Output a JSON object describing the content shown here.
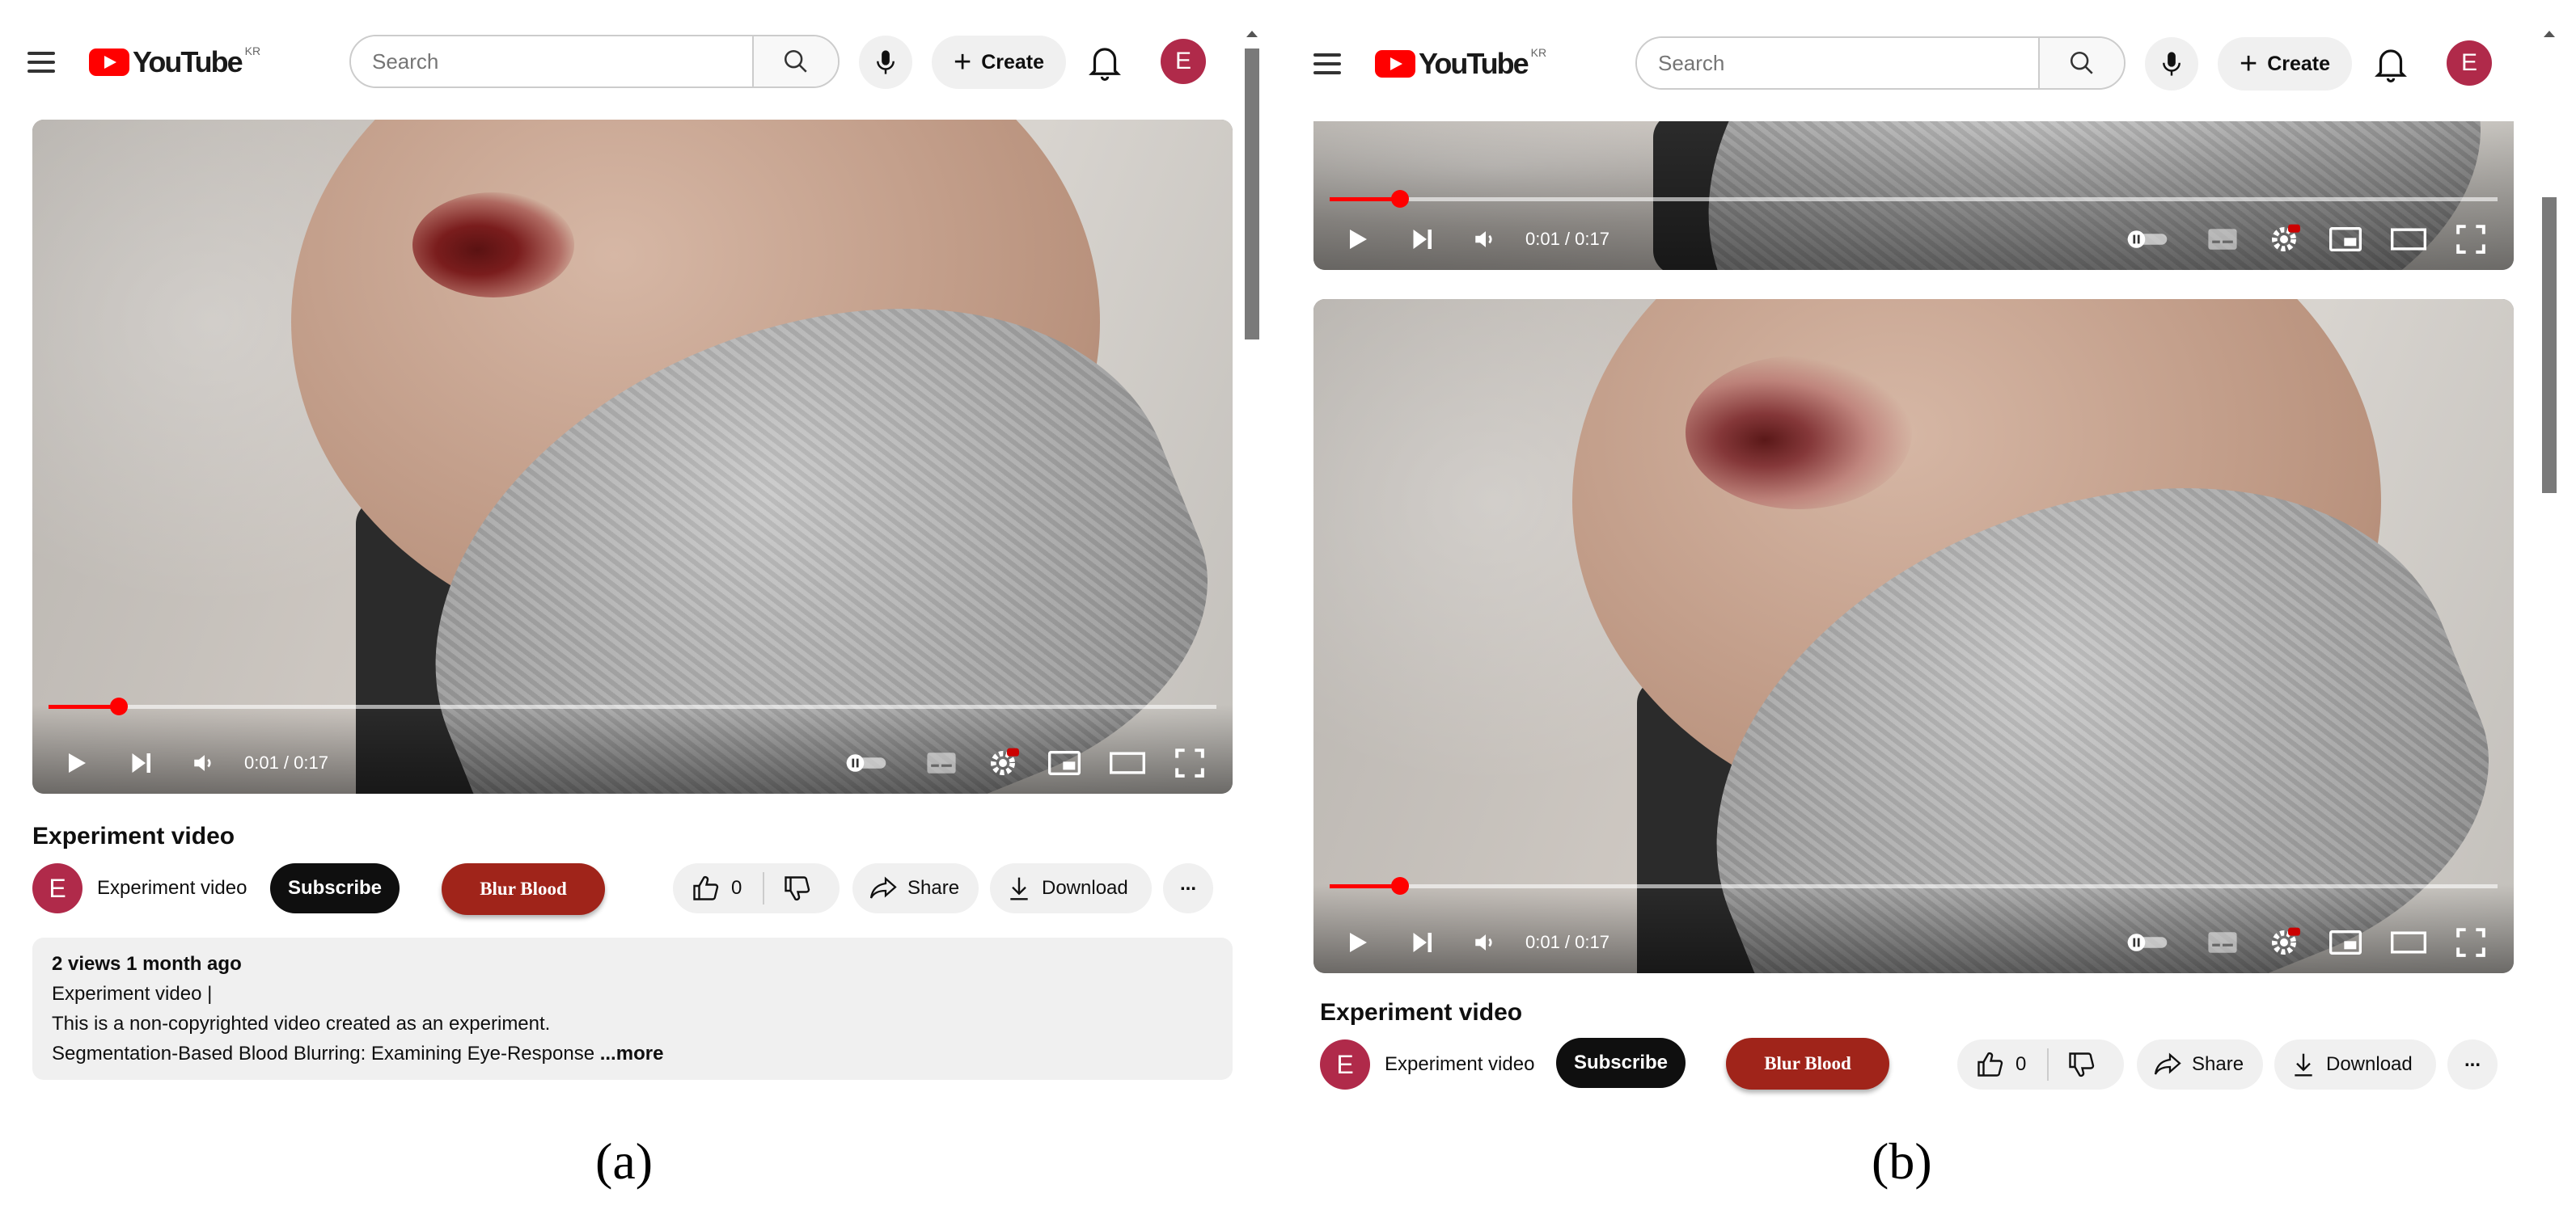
{
  "header": {
    "logo_text": "YouTube",
    "region": "KR",
    "search_placeholder": "Search",
    "create_label": "Create",
    "avatar_letter": "E"
  },
  "player": {
    "time": "0:01 / 0:17",
    "progress_fraction": 0.06,
    "hd_badge": "HD"
  },
  "video": {
    "title": "Experiment video",
    "channel_name": "Experiment video",
    "channel_avatar_letter": "E",
    "subscribe_label": "Subscribe",
    "blur_label": "Blur Blood",
    "like_count": "0",
    "share_label": "Share",
    "download_label": "Download",
    "more_label": "..."
  },
  "description": {
    "meta": "2 views  1 month ago",
    "line1": "Experiment video |",
    "line2": "This is a non-copyrighted video created as an experiment.",
    "line3": "Segmentation-Based Blood Blurring: Examining Eye-Response",
    "more_link": "...more"
  },
  "captions": {
    "a": "(a)",
    "b": "(b)"
  },
  "colors": {
    "brand_red": "#ff0000",
    "avatar": "#b02a4a",
    "blur_button": "#a0241a",
    "subscribe": "#0f0f0f"
  }
}
